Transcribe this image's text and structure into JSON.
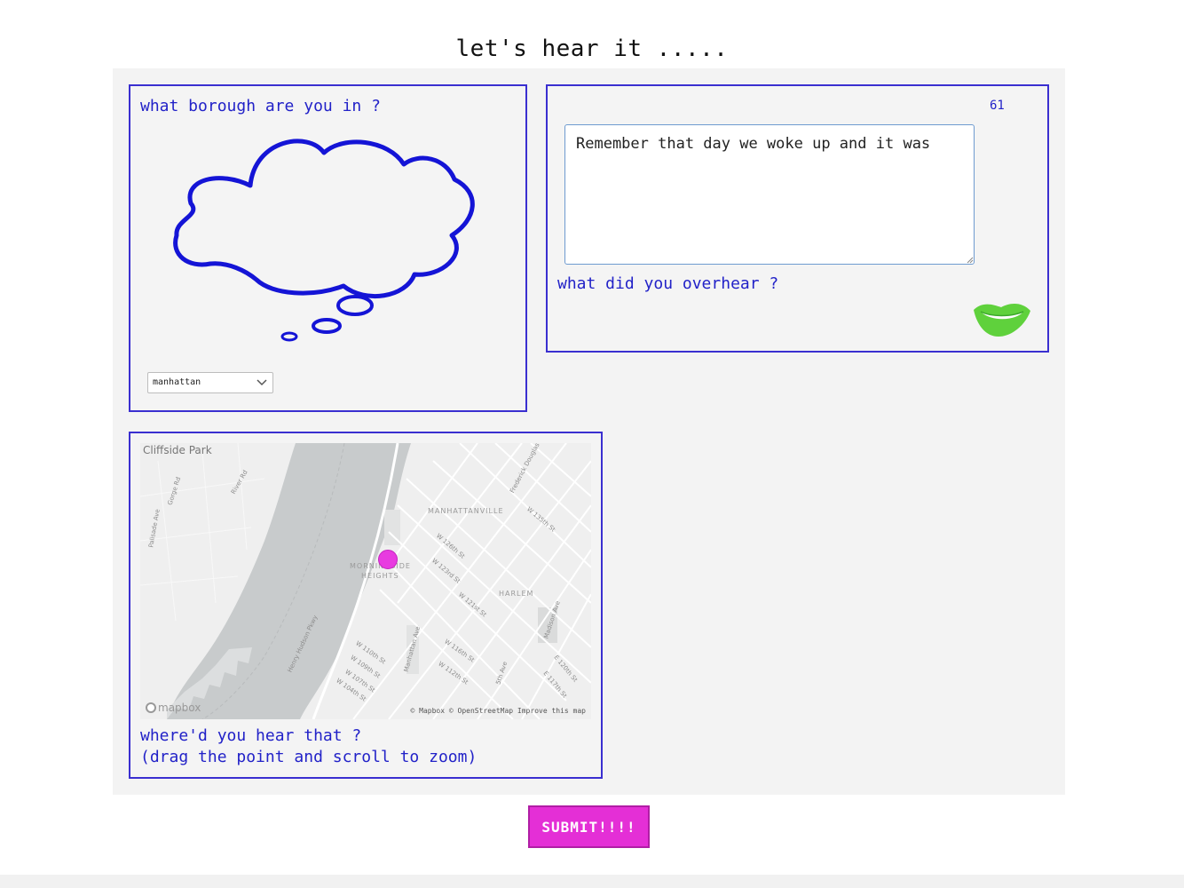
{
  "page": {
    "title": "let's hear it ....."
  },
  "borough": {
    "question": "what borough are you in ?",
    "selected": "manhattan"
  },
  "overhear": {
    "char_count": "61",
    "text_value": "Remember that day we woke up and it was",
    "question": "what did you overhear ?"
  },
  "map": {
    "place_labels": {
      "cliffside": "Cliffside Park",
      "manhattanville": "MANHATTANVILLE",
      "morningside_1": "MORNINGSIDE",
      "morningside_2": "HEIGHTS",
      "harlem": "HARLEM"
    },
    "street_labels": {
      "gorge_rd": "Gorge Rd",
      "river_rd": "River Rd",
      "palisade_ave": "Palisade Ave",
      "frederick_douglass": "Frederick Douglas",
      "w135": "W 135th St",
      "w126": "W 126th St",
      "w123": "W 123rd St",
      "w121": "W 121st St",
      "madison_ave": "Madison Ave",
      "hudson_pkwy": "Henry Hudson Pkwy",
      "manhattan_ave": "Manhattan Ave",
      "w110": "W 110th St",
      "w109": "W 109th St",
      "w107": "W 107th St",
      "w104": "W 104th St",
      "w116": "W 116th St",
      "w112": "W 112th St",
      "fifth_ave": "5th Ave",
      "e120": "E 120th St",
      "e117": "E 117th St"
    },
    "logo": "mapbox",
    "attribution": "© Mapbox © OpenStreetMap Improve this map",
    "question_line1": "where'd you hear that ?",
    "question_line2": "(drag the point and scroll to zoom)"
  },
  "submit": {
    "label": "SUBMIT!!!!"
  },
  "colors": {
    "accent_blue": "#2222c8",
    "panel_border": "#3a2fd0",
    "submit_pink": "#e42fd6",
    "lips_green": "#5fd13c"
  }
}
